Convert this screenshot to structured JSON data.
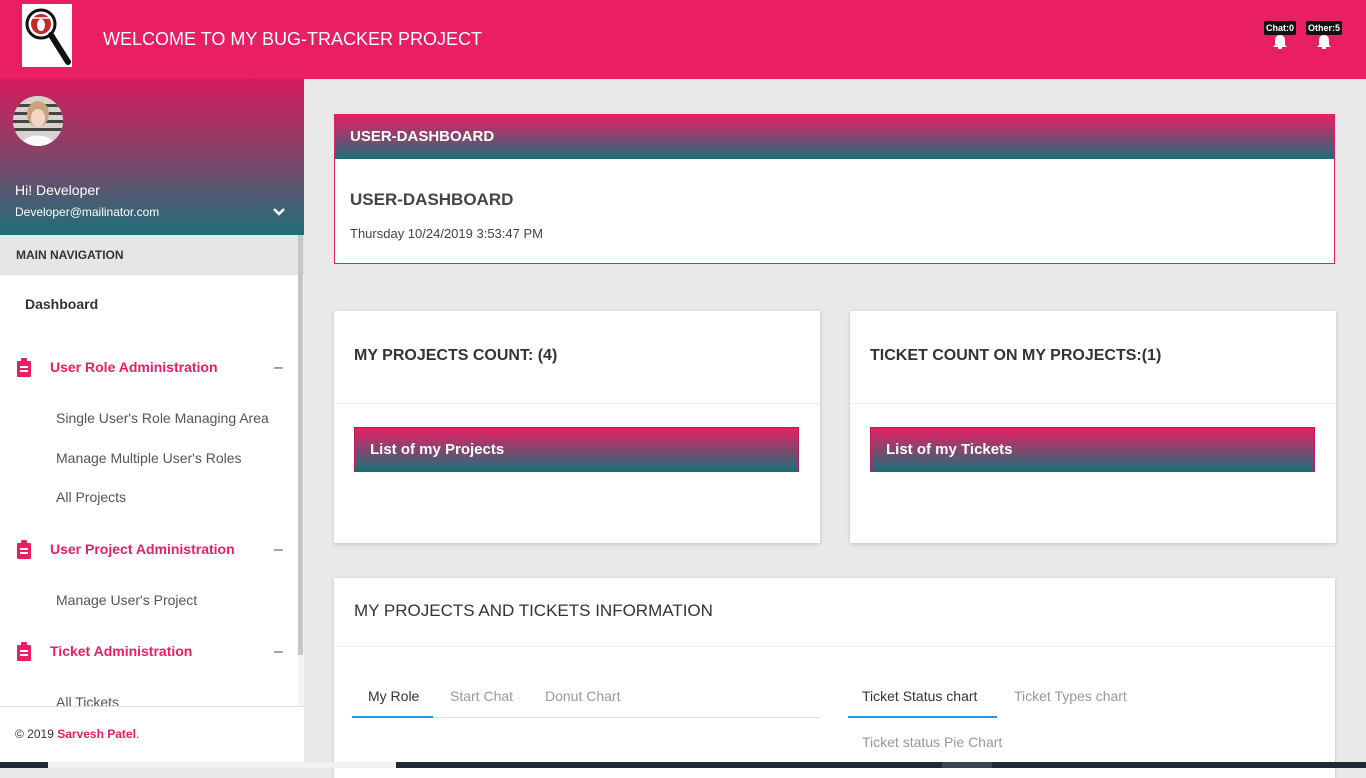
{
  "header": {
    "title": "WELCOME TO MY BUG-TRACKER PROJECT",
    "logo_icon": "bug-magnifier-logo",
    "chat_badge": "Chat:0",
    "other_badge": "Other:5",
    "brand_color": "#e91e63"
  },
  "sidebar": {
    "greeting": "Hi! Developer",
    "email": "Developer@mailinator.com",
    "nav_header": "MAIN NAVIGATION",
    "dashboard": "Dashboard",
    "groups": [
      {
        "label": "User Role Administration",
        "toggle": "–",
        "items": [
          "Single User's Role Managing Area",
          "Manage Multiple User's Roles",
          "All Projects"
        ]
      },
      {
        "label": "User Project Administration",
        "toggle": "–",
        "items": [
          "Manage User's Project"
        ]
      },
      {
        "label": "Ticket Administration",
        "toggle": "–",
        "items": [
          "All Tickets"
        ]
      }
    ],
    "footer_prefix": "© 2019 ",
    "footer_author": "Sarvesh Patel",
    "footer_suffix": "."
  },
  "dashboard": {
    "header": "USER-DASHBOARD",
    "title": "USER-DASHBOARD",
    "datetime": "Thursday 10/24/2019 3:53:47 PM"
  },
  "projects_card": {
    "title": "MY PROJECTS COUNT: (4)",
    "button": "List of my Projects"
  },
  "tickets_card": {
    "title": "TICKET COUNT ON MY PROJECTS:(1)",
    "button": "List of my Tickets"
  },
  "info": {
    "title": "MY PROJECTS AND TICKETS INFORMATION",
    "left_tabs": [
      "My Role",
      "Start Chat",
      "Donut Chart"
    ],
    "right_tabs": [
      "Ticket Status chart",
      "Ticket Types chart"
    ],
    "right_subtitle": "Ticket status Pie Chart"
  }
}
